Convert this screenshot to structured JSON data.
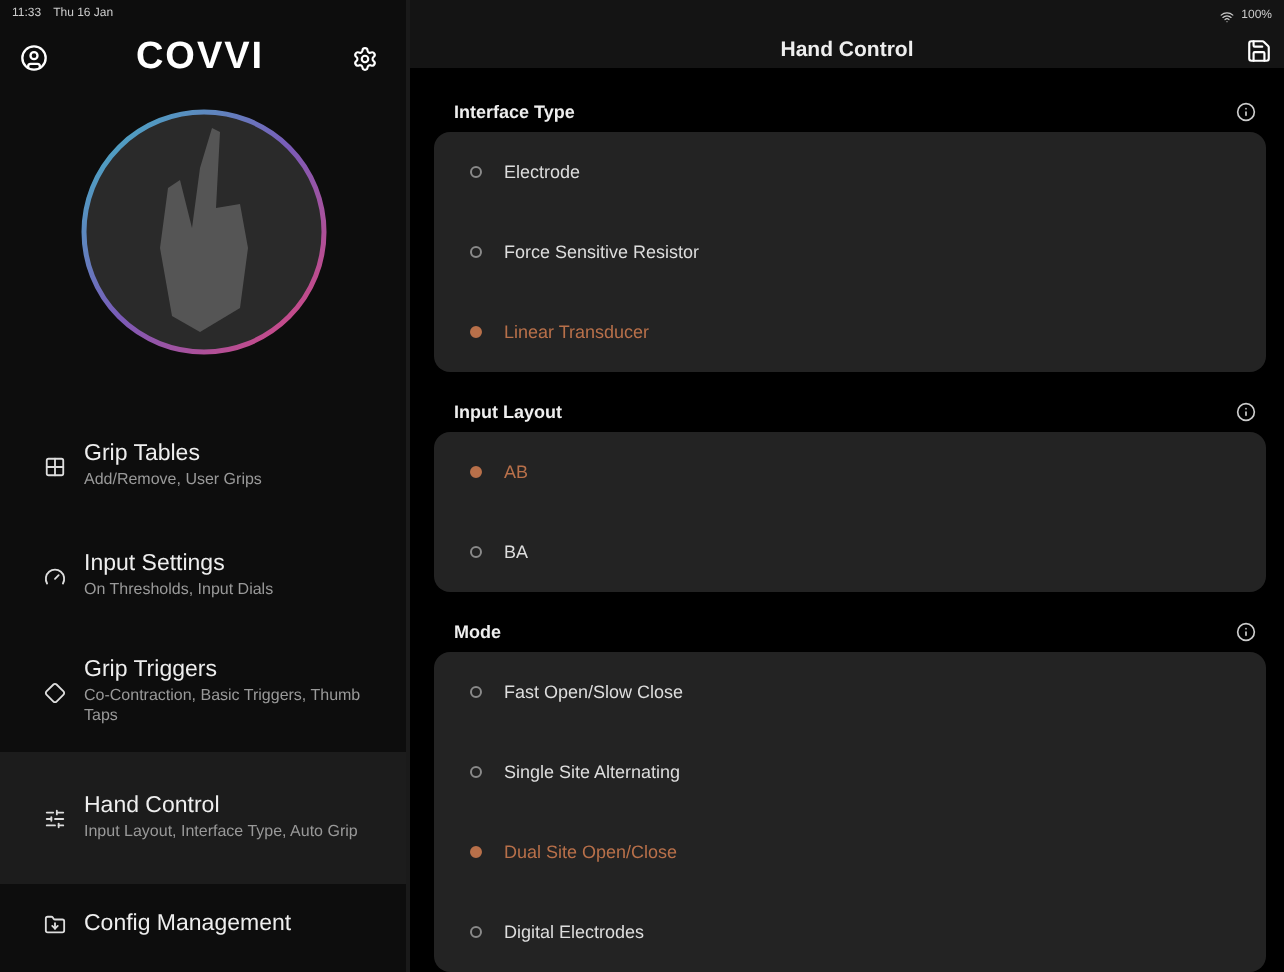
{
  "status_bar": {
    "time": "11:33",
    "date": "Thu 16 Jan",
    "battery": "100%"
  },
  "sidebar": {
    "logo": "COVVI",
    "items": [
      {
        "title": "Grip Tables",
        "subtitle": "Add/Remove, User Grips",
        "selected": false
      },
      {
        "title": "Input Settings",
        "subtitle": "On Thresholds, Input Dials",
        "selected": false
      },
      {
        "title": "Grip Triggers",
        "subtitle": "Co-Contraction, Basic Triggers, Thumb Taps",
        "selected": false
      },
      {
        "title": "Hand Control",
        "subtitle": "Input Layout, Interface Type, Auto Grip",
        "selected": true
      },
      {
        "title": "Config Management",
        "selected": false
      }
    ]
  },
  "header": {
    "title": "Hand Control"
  },
  "sections": [
    {
      "title": "Interface Type",
      "options": [
        {
          "label": "Electrode",
          "selected": false
        },
        {
          "label": "Force Sensitive Resistor",
          "selected": false
        },
        {
          "label": "Linear Transducer",
          "selected": true
        }
      ]
    },
    {
      "title": "Input Layout",
      "options": [
        {
          "label": "AB",
          "selected": true
        },
        {
          "label": "BA",
          "selected": false
        }
      ]
    },
    {
      "title": "Mode",
      "options": [
        {
          "label": "Fast Open/Slow Close",
          "selected": false
        },
        {
          "label": "Single Site Alternating",
          "selected": false
        },
        {
          "label": "Dual Site Open/Close",
          "selected": true
        },
        {
          "label": "Digital Electrodes",
          "selected": false
        }
      ]
    }
  ]
}
